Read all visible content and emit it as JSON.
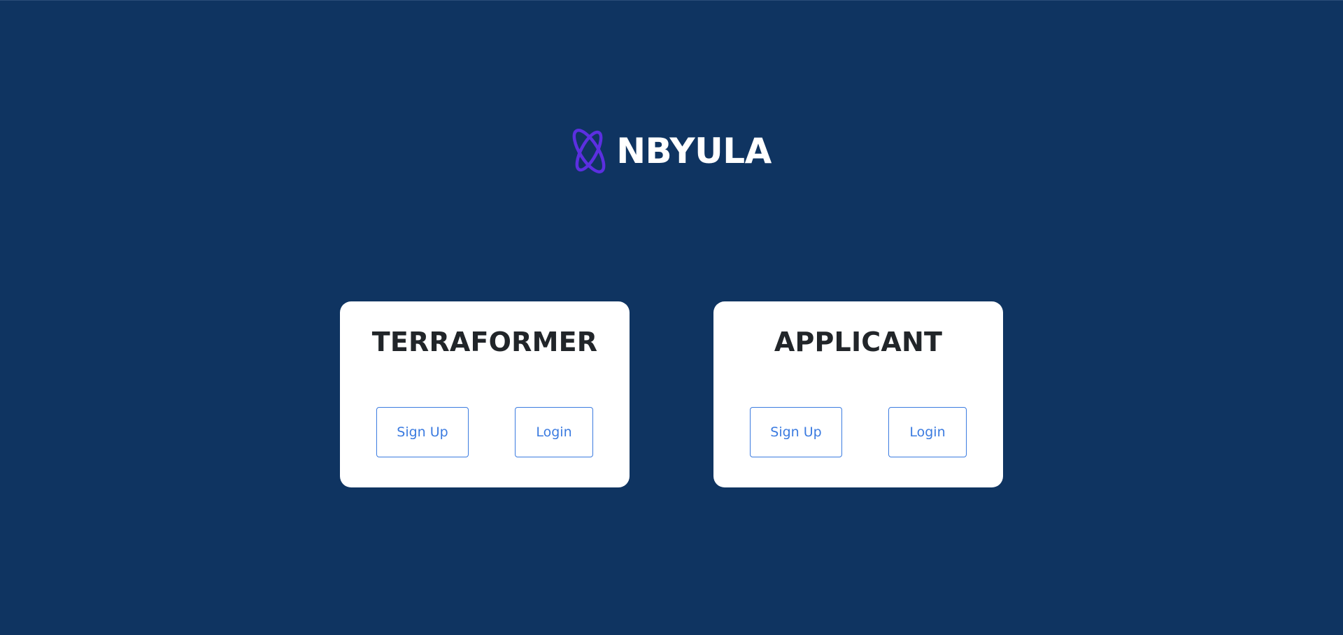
{
  "brand": {
    "name": "NBYULA",
    "logo_icon": "orbit-logo-icon",
    "logo_color": "#5b2fe0"
  },
  "colors": {
    "background": "#0f3461",
    "card": "#ffffff",
    "accent": "#3b7be0",
    "title_text": "#212529"
  },
  "cards": [
    {
      "title": "TERRAFORMER",
      "signup_label": "Sign Up",
      "login_label": "Login"
    },
    {
      "title": "APPLICANT",
      "signup_label": "Sign Up",
      "login_label": "Login"
    }
  ]
}
